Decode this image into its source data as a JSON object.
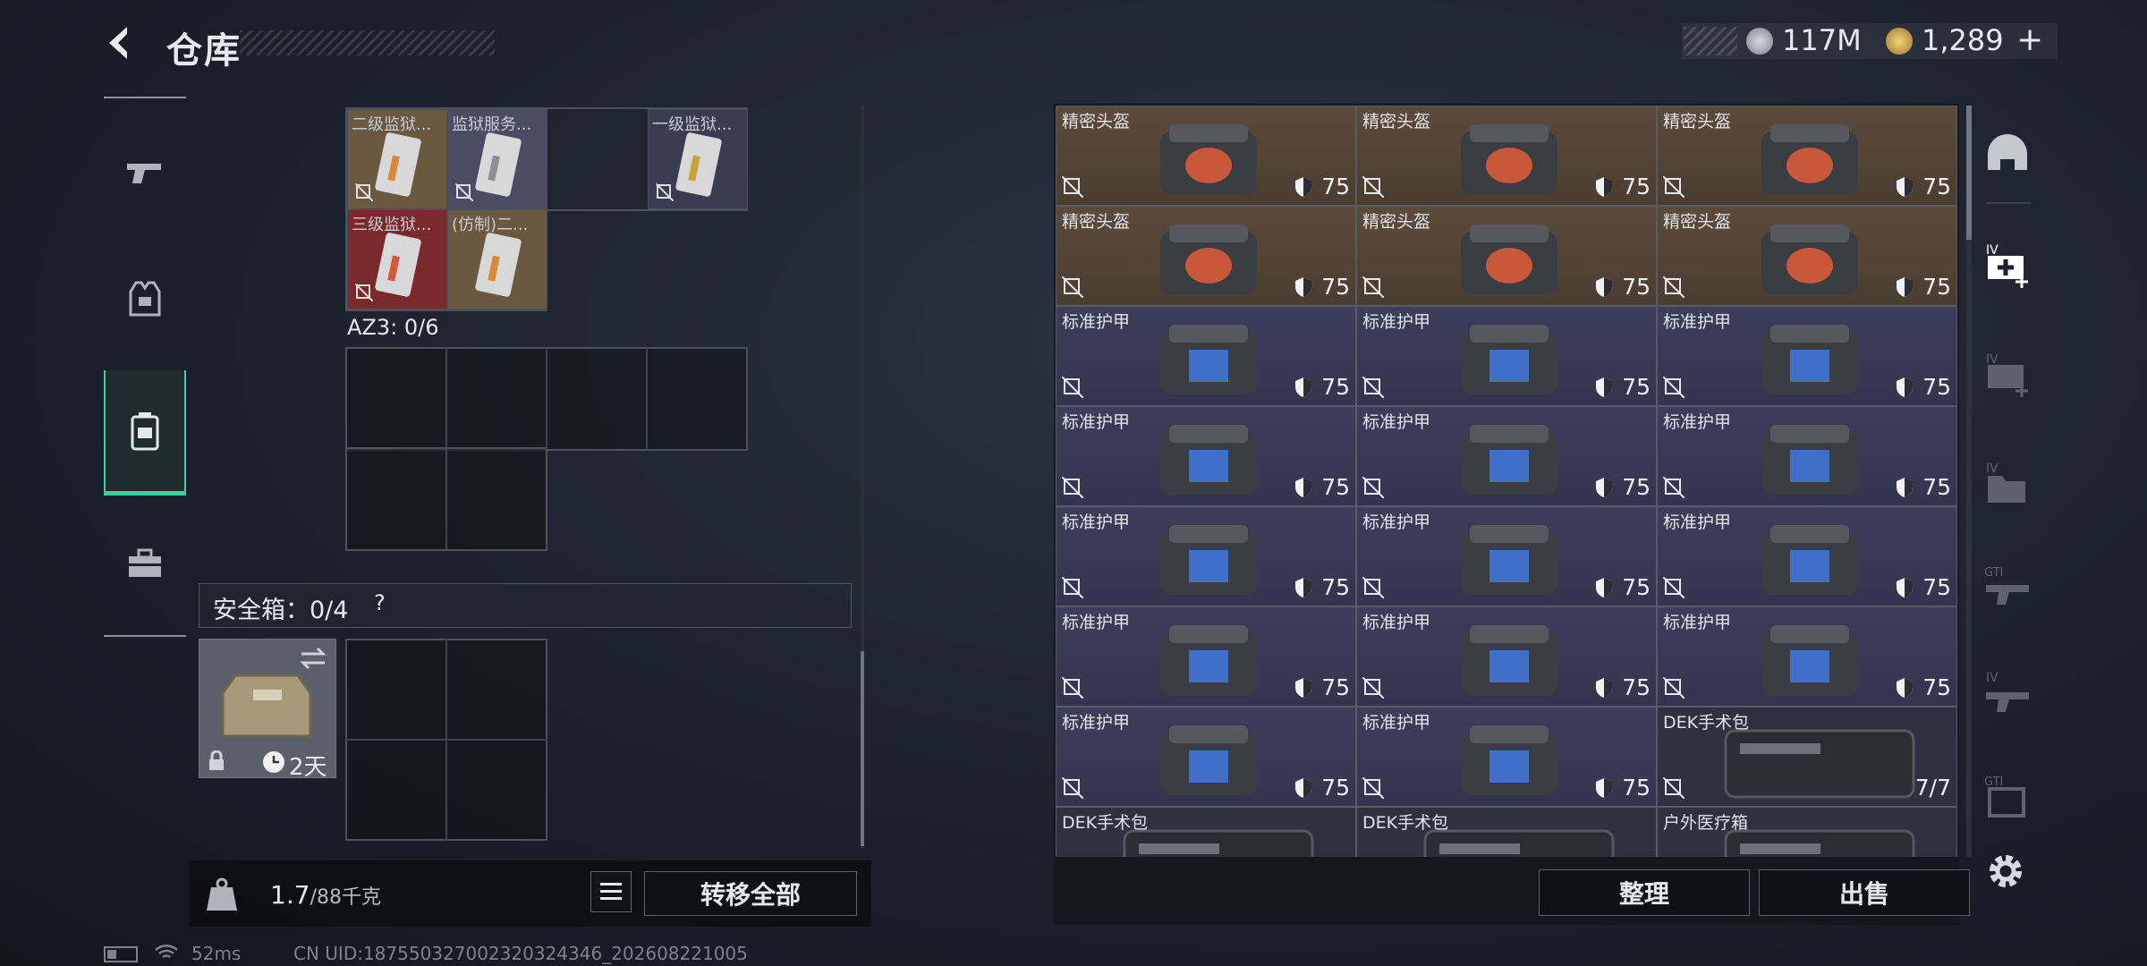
{
  "header": {
    "title": "仓库",
    "currency_silver": "117M",
    "currency_gold": "1,289",
    "add": "+"
  },
  "nav": {
    "items": [
      "weapons",
      "equipment",
      "backpack",
      "toolbox"
    ],
    "active_index": 2
  },
  "stash_top": {
    "items": [
      {
        "label": "二级监狱...",
        "tint": "#6a5840"
      },
      {
        "label": "监狱服务...",
        "tint": "#4a4c63"
      },
      {
        "label": "一级监狱...",
        "tint": "#3a3c52"
      },
      {
        "label": "三级监狱...",
        "tint": "#7a2a2c"
      },
      {
        "label": "(仿制)二...",
        "tint": "#6a5840"
      }
    ]
  },
  "az3": {
    "label": "AZ3: 0/6"
  },
  "safe": {
    "label": "安全箱：",
    "count": "0/4",
    "help": "?",
    "timer": "2天"
  },
  "weight": {
    "value": "1.7",
    "unit": "/88千克"
  },
  "buttons": {
    "transfer_all": "转移全部",
    "sort": "整理",
    "sell": "出售"
  },
  "status": {
    "ping": "52ms",
    "uid": "CN UID:1875503270023203​24346_202608221005"
  },
  "right_items": [
    {
      "name": "精密头盔",
      "kind": "helm",
      "value": "75"
    },
    {
      "name": "精密头盔",
      "kind": "helm",
      "value": "75"
    },
    {
      "name": "精密头盔",
      "kind": "helm",
      "value": "75"
    },
    {
      "name": "精密头盔",
      "kind": "helm",
      "value": "75"
    },
    {
      "name": "精密头盔",
      "kind": "helm",
      "value": "75"
    },
    {
      "name": "精密头盔",
      "kind": "helm",
      "value": "75"
    },
    {
      "name": "标准护甲",
      "kind": "armor",
      "value": "75"
    },
    {
      "name": "标准护甲",
      "kind": "armor",
      "value": "75"
    },
    {
      "name": "标准护甲",
      "kind": "armor",
      "value": "75"
    },
    {
      "name": "标准护甲",
      "kind": "armor",
      "value": "75"
    },
    {
      "name": "标准护甲",
      "kind": "armor",
      "value": "75"
    },
    {
      "name": "标准护甲",
      "kind": "armor",
      "value": "75"
    },
    {
      "name": "标准护甲",
      "kind": "armor",
      "value": "75"
    },
    {
      "name": "标准护甲",
      "kind": "armor",
      "value": "75"
    },
    {
      "name": "标准护甲",
      "kind": "armor",
      "value": "75"
    },
    {
      "name": "标准护甲",
      "kind": "armor",
      "value": "75"
    },
    {
      "name": "标准护甲",
      "kind": "armor",
      "value": "75"
    },
    {
      "name": "标准护甲",
      "kind": "armor",
      "value": "75"
    },
    {
      "name": "标准护甲",
      "kind": "armor",
      "value": "75"
    },
    {
      "name": "标准护甲",
      "kind": "armor",
      "value": "75"
    },
    {
      "name": "DEK手术包",
      "kind": "med",
      "value": "7/7"
    },
    {
      "name": "DEK手术包",
      "kind": "med",
      "value": ""
    },
    {
      "name": "DEK手术包",
      "kind": "med",
      "value": ""
    },
    {
      "name": "户外医疗箱",
      "kind": "med",
      "value": ""
    }
  ],
  "right_sidebar": [
    "helmet-filter",
    "iv-medkit-active",
    "iv-medkit",
    "iv-folder",
    "gti-weapon",
    "iv-weapon",
    "gti-case"
  ],
  "colors": {
    "accent_green": "#35d39a",
    "helmet_bg": "#5b4a3a",
    "armor_bg": "#3a3e5a"
  }
}
